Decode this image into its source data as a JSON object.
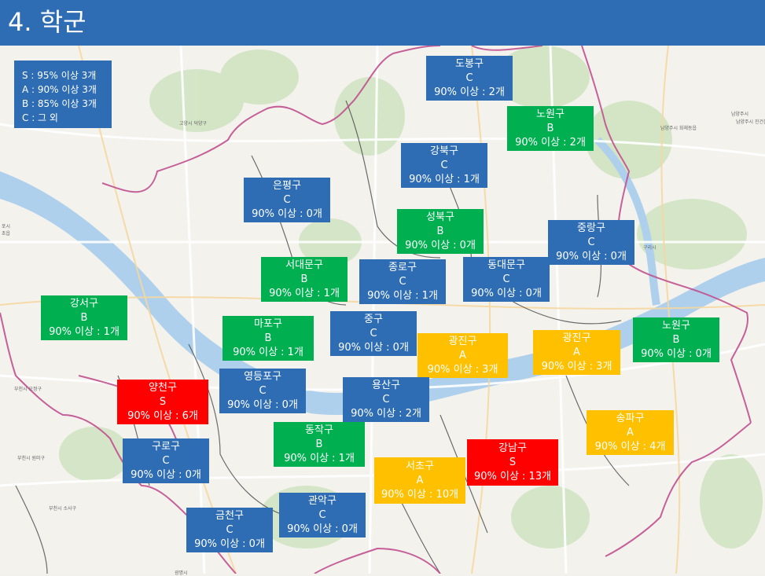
{
  "title": "4. 학군",
  "legend": [
    "S : 95% 이상 3개",
    "A : 90% 이상 3개",
    "B : 85% 이상 3개",
    "C : 그 외"
  ],
  "colors": {
    "S": "#ff0000",
    "A": "#ffc000",
    "B": "#00b050",
    "C": "#2e6db4",
    "header": "#2e6db4"
  },
  "districts": [
    {
      "name": "도봉구",
      "grade": "C",
      "stat": "90% 이상 : 2개"
    },
    {
      "name": "노원구",
      "grade": "B",
      "stat": "90% 이상 : 2개"
    },
    {
      "name": "강북구",
      "grade": "C",
      "stat": "90% 이상 : 1개"
    },
    {
      "name": "은평구",
      "grade": "C",
      "stat": "90% 이상 : 0개"
    },
    {
      "name": "성북구",
      "grade": "B",
      "stat": "90% 이상 : 0개"
    },
    {
      "name": "중랑구",
      "grade": "C",
      "stat": "90% 이상 : 0개"
    },
    {
      "name": "서대문구",
      "grade": "B",
      "stat": "90% 이상 : 1개"
    },
    {
      "name": "종로구",
      "grade": "C",
      "stat": "90% 이상 : 1개"
    },
    {
      "name": "동대문구",
      "grade": "C",
      "stat": "90% 이상 : 0개"
    },
    {
      "name": "강서구",
      "grade": "B",
      "stat": "90% 이상 : 1개"
    },
    {
      "name": "마포구",
      "grade": "B",
      "stat": "90% 이상 : 1개"
    },
    {
      "name": "중구",
      "grade": "C",
      "stat": "90% 이상 : 0개"
    },
    {
      "name": "광진구",
      "grade": "A",
      "stat": "90% 이상 : 3개"
    },
    {
      "name": "광진구",
      "grade": "A",
      "stat": "90% 이상 : 3개"
    },
    {
      "name": "노원구",
      "grade": "B",
      "stat": "90% 이상 : 0개"
    },
    {
      "name": "양천구",
      "grade": "S",
      "stat": "90% 이상 : 6개"
    },
    {
      "name": "영등포구",
      "grade": "C",
      "stat": "90% 이상 : 0개"
    },
    {
      "name": "용산구",
      "grade": "C",
      "stat": "90% 이상 : 2개"
    },
    {
      "name": "송파구",
      "grade": "A",
      "stat": "90% 이상 : 4개"
    },
    {
      "name": "동작구",
      "grade": "B",
      "stat": "90% 이상 : 1개"
    },
    {
      "name": "구로구",
      "grade": "C",
      "stat": "90% 이상 : 0개"
    },
    {
      "name": "강남구",
      "grade": "S",
      "stat": "90% 이상 : 13개"
    },
    {
      "name": "서초구",
      "grade": "A",
      "stat": "90% 이상 : 10개"
    },
    {
      "name": "관악구",
      "grade": "C",
      "stat": "90% 이상 : 0개"
    },
    {
      "name": "금천구",
      "grade": "C",
      "stat": "90% 이상 : 0개"
    }
  ],
  "map_labels": [
    "고양시 덕양구",
    "남양주시",
    "남양주시 화체동읍",
    "남양주시 진건읍",
    "구리시",
    "부천시 오정구",
    "부천시 원미구",
    "부천시 소사구",
    "광명시",
    "포시",
    "초읍"
  ]
}
